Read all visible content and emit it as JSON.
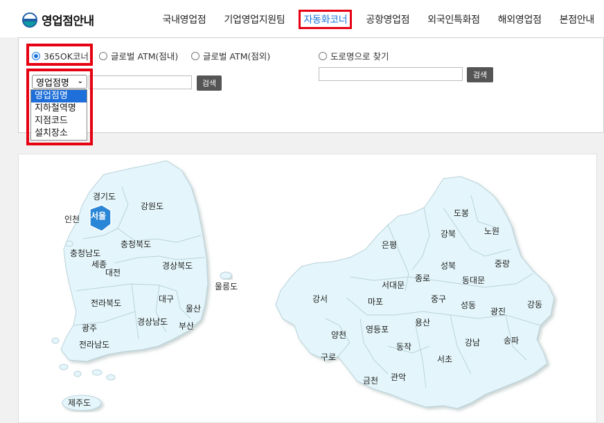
{
  "header": {
    "logo_text": "영업점안내",
    "nav": [
      "국내영업점",
      "기업영업지원팀",
      "자동화코너",
      "공항영업점",
      "외국인특화점",
      "해외영업점",
      "본점안내"
    ],
    "active_index": 2
  },
  "search": {
    "radios": [
      "365OK코너",
      "글로벌 ATM(점내)",
      "글로벌 ATM(점외)",
      "도로명으로 찾기"
    ],
    "selected_radio": "365OK코너",
    "select_value": "영업점명",
    "select_options": [
      "영업점명",
      "지하철역명",
      "지점코드",
      "설치장소"
    ],
    "search_button": "검색",
    "road_search_button": "검색"
  },
  "korea_map": {
    "regions": [
      "경기도",
      "강원도",
      "인천",
      "서울",
      "충청북도",
      "충청남도",
      "세종",
      "대전",
      "경상북도",
      "울릉도",
      "대구",
      "전라북도",
      "울산",
      "광주",
      "경상남도",
      "부산",
      "전라남도",
      "제주도"
    ],
    "highlighted": "서울"
  },
  "seoul_map": {
    "districts": [
      "도봉",
      "강북",
      "노원",
      "은평",
      "성북",
      "중랑",
      "종로",
      "동대문",
      "서대문",
      "강서",
      "마포",
      "중구",
      "성동",
      "광진",
      "강동",
      "용산",
      "영등포",
      "양천",
      "동작",
      "강남",
      "송파",
      "구로",
      "서초",
      "금천",
      "관악"
    ]
  },
  "colors": {
    "highlight_border": "#e60012",
    "accent": "#1a73d9",
    "map_fill": "#e4f6fb",
    "seoul_fill": "#2a86d6"
  }
}
